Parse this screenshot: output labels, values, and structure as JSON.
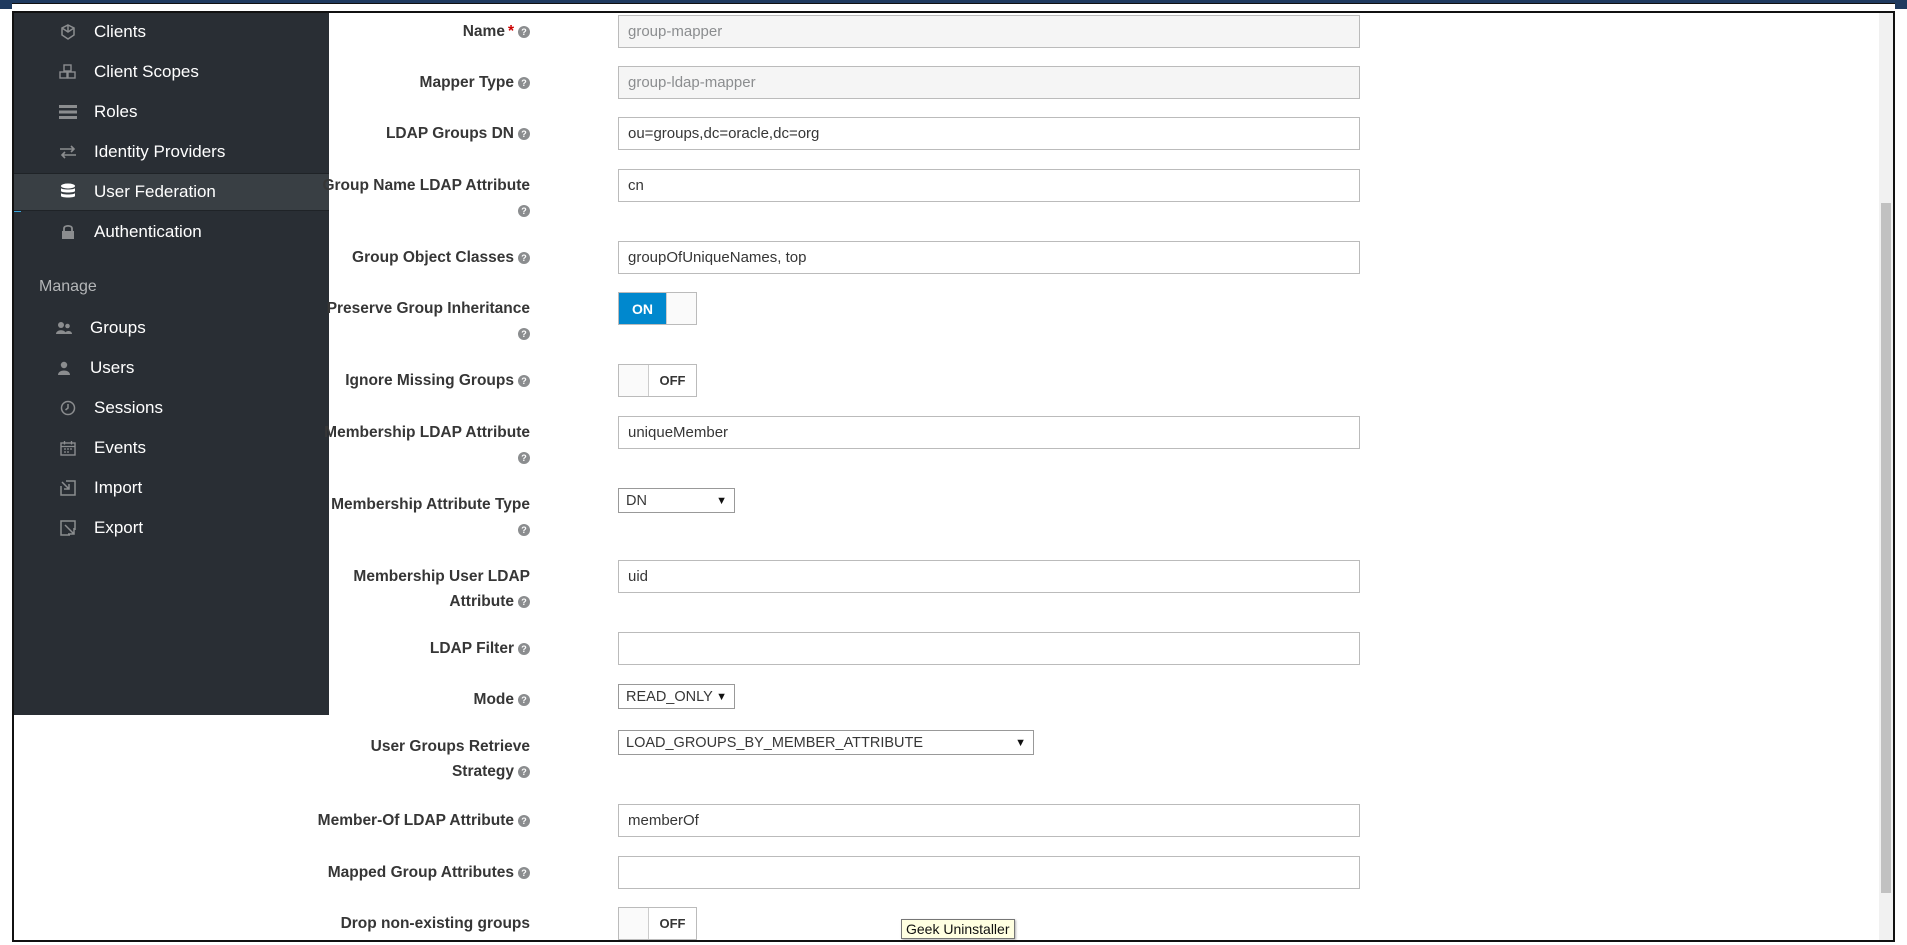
{
  "sidebar": {
    "items": [
      {
        "label": "Clients",
        "icon": "cube-icon"
      },
      {
        "label": "Client Scopes",
        "icon": "cubes-icon"
      },
      {
        "label": "Roles",
        "icon": "list-icon"
      },
      {
        "label": "Identity Providers",
        "icon": "exchange-icon"
      },
      {
        "label": "User Federation",
        "icon": "database-icon",
        "active": true
      },
      {
        "label": "Authentication",
        "icon": "lock-icon"
      }
    ],
    "manage_label": "Manage",
    "manage_items": [
      {
        "label": "Groups",
        "icon": "users-icon"
      },
      {
        "label": "Users",
        "icon": "user-icon"
      },
      {
        "label": "Sessions",
        "icon": "clock-icon"
      },
      {
        "label": "Events",
        "icon": "calendar-icon"
      },
      {
        "label": "Import",
        "icon": "import-icon"
      },
      {
        "label": "Export",
        "icon": "export-icon"
      }
    ]
  },
  "form": {
    "name": {
      "label": "Name",
      "value": "group-mapper"
    },
    "mapper_type": {
      "label": "Mapper Type",
      "value": "group-ldap-mapper"
    },
    "ldap_groups_dn": {
      "label": "LDAP Groups DN",
      "value": "ou=groups,dc=oracle,dc=org"
    },
    "group_name_attr": {
      "label": "Group Name LDAP Attribute",
      "value": "cn"
    },
    "group_object_classes": {
      "label": "Group Object Classes",
      "value": "groupOfUniqueNames, top"
    },
    "preserve_inheritance": {
      "label": "Preserve Group Inheritance",
      "state": "ON"
    },
    "ignore_missing": {
      "label": "Ignore Missing Groups",
      "state": "OFF"
    },
    "membership_attr": {
      "label": "Membership LDAP Attribute",
      "value": "uniqueMember"
    },
    "membership_attr_type": {
      "label": "Membership Attribute Type",
      "value": "DN"
    },
    "membership_user_attr": {
      "label_line1": "Membership User LDAP",
      "label_line2": "Attribute",
      "value": "uid"
    },
    "ldap_filter": {
      "label": "LDAP Filter",
      "value": ""
    },
    "mode": {
      "label": "Mode",
      "value": "READ_ONLY"
    },
    "retrieve_strategy": {
      "label_line1": "User Groups Retrieve",
      "label_line2": "Strategy",
      "value": "LOAD_GROUPS_BY_MEMBER_ATTRIBUTE"
    },
    "member_of_attr": {
      "label": "Member-Of LDAP Attribute",
      "value": "memberOf"
    },
    "mapped_group_attrs": {
      "label": "Mapped Group Attributes",
      "value": ""
    },
    "drop_non_existing": {
      "label": "Drop non-existing groups",
      "state": "OFF"
    }
  },
  "tooltip": "Geek Uninstaller",
  "colors": {
    "sidebar_bg": "#292e34",
    "active_accent": "#39a5dc",
    "toggle_on": "#0088ce"
  }
}
